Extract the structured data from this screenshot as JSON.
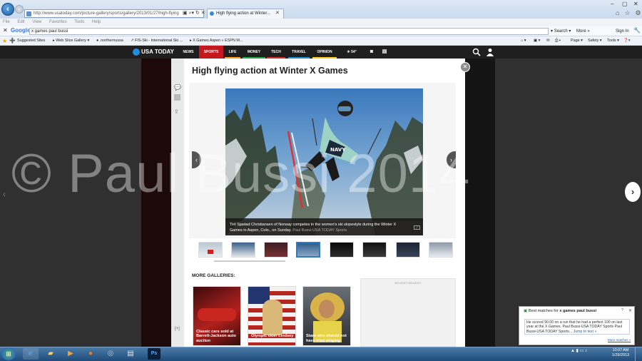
{
  "browser": {
    "url": "http://www.usatoday.com/picture-gallery/sports/gallery/2013/01/27/high-flying",
    "tab_title": "High flying action at Winter...",
    "menu": [
      "File",
      "Edit",
      "View",
      "Favorites",
      "Tools",
      "Help"
    ],
    "google_toolbar": {
      "logo": "Google",
      "query": "x games paul bussi",
      "search_label": "Search",
      "more_label": "More »",
      "signin_label": "Sign In"
    },
    "favorites": [
      "Suggested Sites",
      "Web Slice Gallery",
      ".northernussa",
      "FIS-Ski - International Ski ...",
      "X Games Aspen « ESPN M..."
    ],
    "command_bar": [
      "Page",
      "Safety",
      "Tools"
    ]
  },
  "site": {
    "logo": "USA TODAY",
    "nav": [
      "NEWS",
      "SPORTS",
      "LIFE",
      "MONEY",
      "TECH",
      "TRAVEL",
      "OPINION"
    ],
    "weather": "54°",
    "colors": {
      "sports": "#c4171e",
      "life": "#ff9d1e",
      "money": "#24a64a",
      "tech": "#cc2c2c",
      "travel": "#1f8fd3",
      "opinion": "#ffc820"
    }
  },
  "gallery": {
    "title": "High flying action at Winter X Games",
    "caption": "Tiril Sjastad Christiansen of Norway competes in the women's ski slopestyle during the Winter X Games in Aspen, Colo., on Sunday.",
    "credit": "Paul Bussi-USA TODAY Sports",
    "photo_text": "NAVY",
    "thumbs_count": 8,
    "selected_index": 3
  },
  "more_galleries": {
    "title": "MORE GALLERIES:",
    "items": [
      "Classic cars sold at Barrett-Jackson auto auction",
      "Olympic skier Lindsey Vonn",
      "Stars who should not have tried singing"
    ],
    "ad_label": "ADVERTISEMENT"
  },
  "watermark": "© Paul Bussi 2014",
  "popup": {
    "heading_prefix": "Best matches for",
    "heading_query": "x games paul bussi",
    "body": "He scored 90.00 on a run that he had a perfect 100 on last year at the X Games. Paul Bussi-USA TODAY Sports Paul Bussi-USA TODAY Sports...",
    "jump_link": "Jump to text »",
    "more_link": "More matches »"
  },
  "taskbar": {
    "time": "10:07 AM",
    "date": "1/29/2013"
  }
}
